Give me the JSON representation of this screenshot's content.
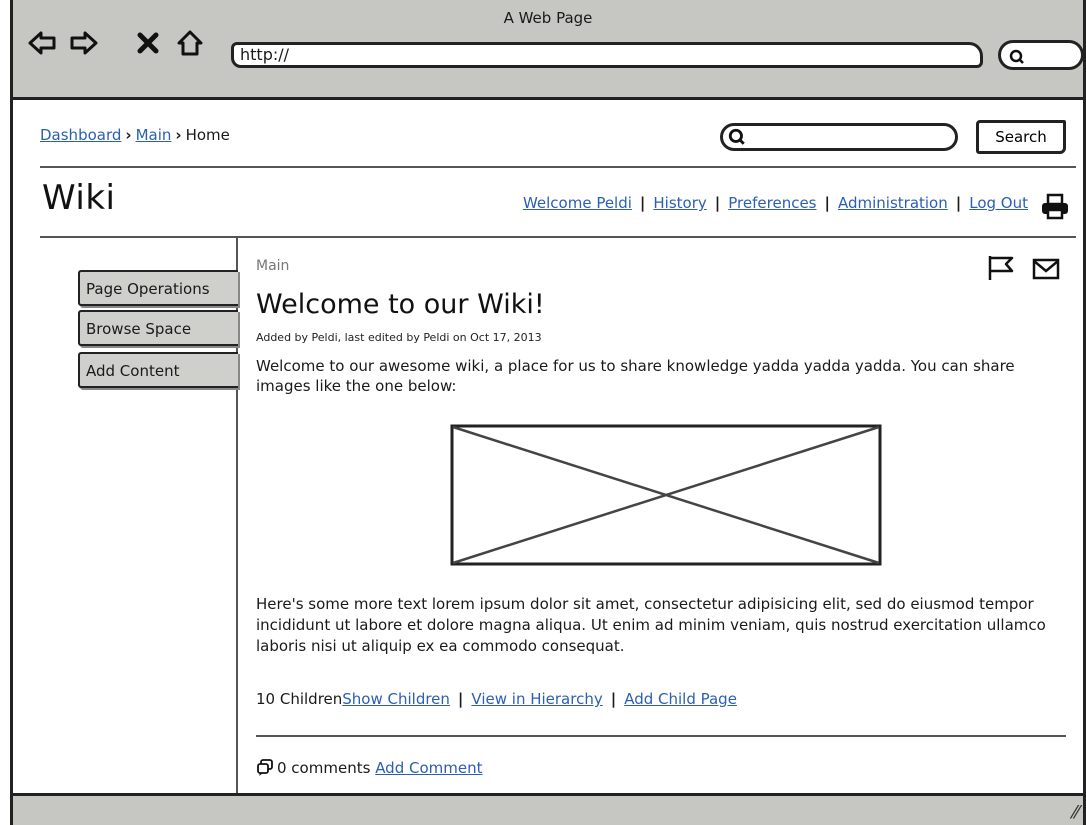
{
  "window": {
    "title": "A Web Page",
    "url": "http://"
  },
  "breadcrumb": {
    "items": [
      "Dashboard",
      "Main"
    ],
    "current": "Home",
    "separator": "›"
  },
  "search": {
    "placeholder": "",
    "button_label": "Search"
  },
  "header": {
    "title": "Wiki",
    "nav": [
      "Welcome Peldi",
      "History",
      "Preferences",
      "Administration",
      "Log Out"
    ]
  },
  "sidebar": {
    "items": [
      "Page Operations",
      "Browse Space",
      "Add Content"
    ]
  },
  "main": {
    "breadcrumb": "Main",
    "title": "Welcome to our Wiki!",
    "meta": "Added by Peldi, last edited by Peldi on Oct 17, 2013",
    "intro": "Welcome to our awesome wiki, a place for us to share knowledge yadda yadda yadda. You can share images like the one below:",
    "body": "Here's some more text lorem ipsum dolor sit amet, consectetur adipisicing elit, sed do eiusmod tempor incididunt ut labore et dolore magna aliqua. Ut enim ad minim veniam, quis nostrud exercitation ullamco laboris nisi ut aliquip ex ea commodo consequat.",
    "children_count": "10 Children",
    "children_links": [
      "Show Children",
      "View in Hierarchy",
      "Add Child Page"
    ],
    "comments_count": "0 comments",
    "add_comment": "Add Comment"
  },
  "icons": {
    "back": "back-arrow-icon",
    "forward": "forward-arrow-icon",
    "stop": "close-icon",
    "home": "home-icon",
    "print": "printer-icon",
    "flag": "flag-icon",
    "mail": "mail-icon",
    "comment": "comment-icon"
  }
}
